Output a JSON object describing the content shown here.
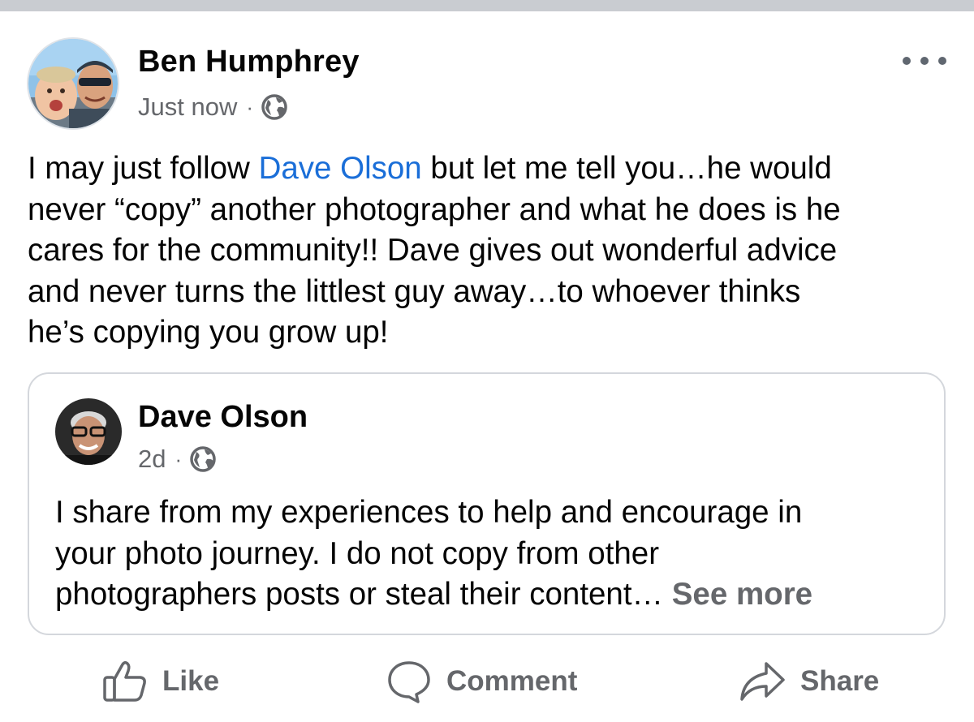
{
  "post": {
    "author": "Ben Humphrey",
    "timestamp": "Just now",
    "separator": "·",
    "audience_icon": "globe-icon",
    "menu_icon": "more-options-icon",
    "text_before_mention": "I may just follow ",
    "mention": "Dave Olson",
    "text_after_mention": " but let me tell you…he would\nnever “copy” another photographer and what he does is he\ncares for the community!! Dave gives out wonderful advice\nand never turns the littlest guy away…to whoever thinks\nhe’s copying you grow up!"
  },
  "shared_post": {
    "author": "Dave Olson",
    "timestamp": "2d",
    "separator": "·",
    "audience_icon": "globe-icon",
    "text": "I share from my experiences to help and encourage in\nyour photo journey. I do not copy from other\nphotographers posts or steal their content… ",
    "see_more": "See more"
  },
  "actions": {
    "like": "Like",
    "comment": "Comment",
    "share": "Share"
  },
  "colors": {
    "mention": "#1a6ed8",
    "secondary_text": "#65676b",
    "divider": "#c9ccd1",
    "card_border": "#d4d7dc"
  }
}
